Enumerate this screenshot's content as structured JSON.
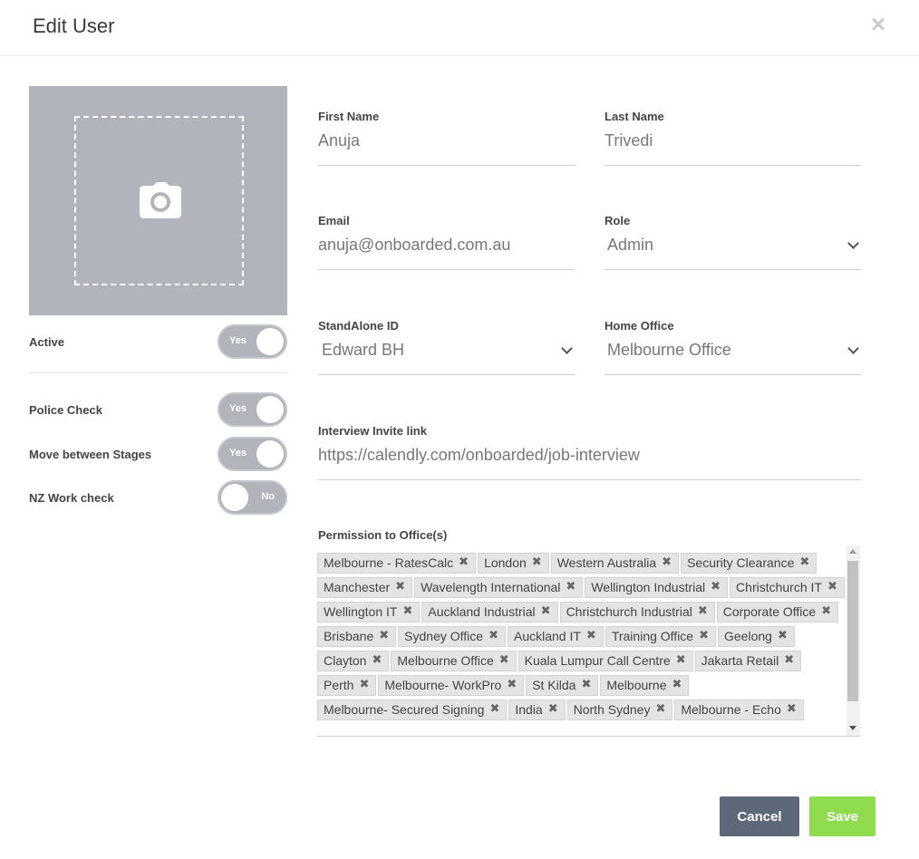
{
  "modal": {
    "title": "Edit User",
    "close_symbol": "×"
  },
  "photo": {
    "icon": "camera-icon"
  },
  "toggles": {
    "active": {
      "label": "Active",
      "state": "Yes",
      "on": true
    },
    "police_check": {
      "label": "Police Check",
      "state": "Yes",
      "on": true
    },
    "move_between_stages": {
      "label": "Move between Stages",
      "state": "Yes",
      "on": true
    },
    "nz_work_check": {
      "label": "NZ Work check",
      "state": "No",
      "on": false
    }
  },
  "fields": {
    "first_name": {
      "label": "First Name",
      "value": "Anuja"
    },
    "last_name": {
      "label": "Last Name",
      "value": "Trivedi"
    },
    "email": {
      "label": "Email",
      "value": "anuja@onboarded.com.au"
    },
    "role": {
      "label": "Role",
      "value": "Admin"
    },
    "standalone_id": {
      "label": "StandAlone ID",
      "value": "Edward BH"
    },
    "home_office": {
      "label": "Home Office",
      "value": "Melbourne Office"
    },
    "interview_link": {
      "label": "Interview Invite link",
      "value": "https://calendly.com/onboarded/job-interview"
    }
  },
  "permissions": {
    "label": "Permission to Office(s)",
    "remove_symbol": "✖",
    "offices": [
      "Melbourne - RatesCalc",
      "London",
      "Western Australia",
      "Security Clearance",
      "Manchester",
      "Wavelength International",
      "Wellington Industrial",
      "Christchurch IT",
      "Wellington IT",
      "Auckland Industrial",
      "Christchurch Industrial",
      "Corporate Office",
      "Brisbane",
      "Sydney Office",
      "Auckland IT",
      "Training Office",
      "Geelong",
      "Clayton",
      "Melbourne Office",
      "Kuala Lumpur Call Centre",
      "Jakarta Retail",
      "Perth",
      "Melbourne- WorkPro",
      "St Kilda",
      "Melbourne",
      "Melbourne- Secured Signing",
      "India",
      "North Sydney",
      "Melbourne - Echo"
    ]
  },
  "buttons": {
    "cancel": "Cancel",
    "save": "Save"
  },
  "colors": {
    "photo_bg": "#b1b4bb",
    "toggle_bg": "#b1b4bb",
    "cancel_bg": "#5d6879",
    "save_bg": "#8fdd4e",
    "tag_bg": "#e4e4e4"
  }
}
